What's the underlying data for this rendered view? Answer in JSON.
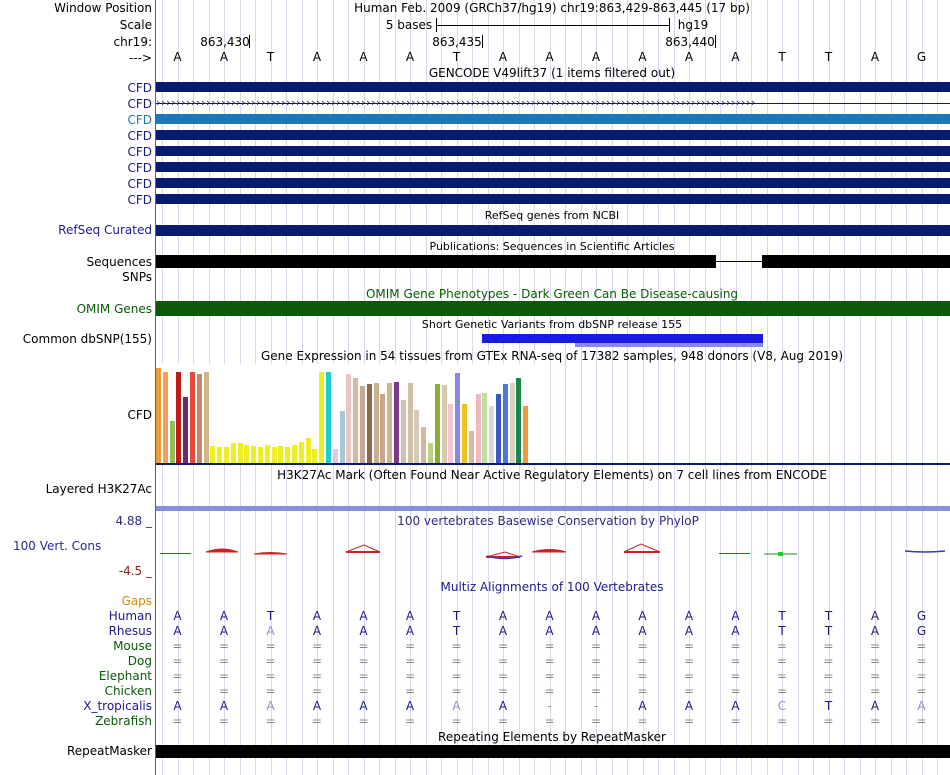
{
  "header": {
    "window_position_label": "Window Position",
    "window_position_text": "Human Feb. 2009 (GRCh37/hg19)   chr19:863,429-863,445 (17 bp)",
    "scale_label": "Scale",
    "scale_text": "5 bases",
    "assembly": "hg19",
    "chrom_label": "chr19:",
    "ticks": [
      "863,430",
      "863,435",
      "863,440"
    ],
    "strand_label": "--->"
  },
  "bases": [
    "A",
    "A",
    "T",
    "A",
    "A",
    "A",
    "T",
    "A",
    "A",
    "A",
    "A",
    "A",
    "A",
    "T",
    "T",
    "A",
    "G"
  ],
  "tracks": {
    "gencode_title": "GENCODE V49lift37 (1 items filtered out)",
    "gencode_items": [
      "CFD",
      "CFD",
      "CFD",
      "CFD",
      "CFD",
      "CFD",
      "CFD",
      "CFD"
    ],
    "refseq_title": "RefSeq genes from NCBI",
    "refseq_label": "RefSeq Curated",
    "publications_title": "Publications: Sequences in Scientific Articles",
    "sequences_label": "Sequences",
    "snps_label": "SNPs",
    "omim_label": "OMIM Genes",
    "omim_title": "OMIM Gene Phenotypes - Dark Green Can Be Disease-causing",
    "dbsnp_title": "Short Genetic Variants from dbSNP release 155",
    "dbsnp_label": "Common dbSNP(155)",
    "gtex_title": "Gene Expression in 54 tissues from GTEx RNA-seq of 17382 samples, 948 donors (V8, Aug 2019)",
    "gtex_label": "CFD",
    "h3k27_title": "H3K27Ac Mark (Often Found Near Active Regulatory Elements) on 7 cell lines from ENCODE",
    "h3k27_label": "Layered H3K27Ac",
    "phylop_max": "4.88 _",
    "phylop_title": "100 vertebrates Basewise Conservation by PhyloP",
    "phylop_label": "100 Vert. Cons",
    "phylop_min": "-4.5 _",
    "multiz_title": "Multiz Alignments of 100 Vertebrates",
    "gaps_label": "Gaps",
    "repeat_title": "Repeating Elements by RepeatMasker",
    "repeat_label": "RepeatMasker"
  },
  "alignment": [
    {
      "species": "Human",
      "row": [
        "A",
        "A",
        "T",
        "A",
        "A",
        "A",
        "T",
        "A",
        "A",
        "A",
        "A",
        "A",
        "A",
        "T",
        "T",
        "A",
        "G"
      ]
    },
    {
      "species": "Rhesus",
      "row": [
        "A",
        "A",
        "A",
        "A",
        "A",
        "A",
        "T",
        "A",
        "A",
        "A",
        "A",
        "A",
        "A",
        "T",
        "T",
        "A",
        "G"
      ]
    },
    {
      "species": "Mouse",
      "row": [
        "=",
        "=",
        "=",
        "=",
        "=",
        "=",
        "=",
        "=",
        "=",
        "=",
        "=",
        "=",
        "=",
        "=",
        "=",
        "=",
        "="
      ]
    },
    {
      "species": "Dog",
      "row": [
        "=",
        "=",
        "=",
        "=",
        "=",
        "=",
        "=",
        "=",
        "=",
        "=",
        "=",
        "=",
        "=",
        "=",
        "=",
        "=",
        "="
      ]
    },
    {
      "species": "Elephant",
      "row": [
        "=",
        "=",
        "=",
        "=",
        "=",
        "=",
        "=",
        "=",
        "=",
        "=",
        "=",
        "=",
        "=",
        "=",
        "=",
        "=",
        "="
      ]
    },
    {
      "species": "Chicken",
      "row": [
        "=",
        "=",
        "=",
        "=",
        "=",
        "=",
        "=",
        "=",
        "=",
        "=",
        "=",
        "=",
        "=",
        "=",
        "=",
        "=",
        "="
      ]
    },
    {
      "species": "X_tropicalis",
      "row": [
        "A",
        "A",
        "A",
        "A",
        "A",
        "A",
        "A",
        "A",
        "-",
        "-",
        "A",
        "A",
        "A",
        "C",
        "T",
        "A",
        "A"
      ]
    },
    {
      "species": "Zebrafish",
      "row": [
        "=",
        "=",
        "=",
        "=",
        "=",
        "=",
        "=",
        "=",
        "=",
        "=",
        "=",
        "=",
        "=",
        "=",
        "=",
        "=",
        "="
      ]
    }
  ],
  "colors": {
    "gene_navy": "#0a1a6e",
    "gene_highlight": "#1a78b8",
    "label_navy": "#1a1a8c",
    "omim_green": "#0a5a0a",
    "gaps_orange": "#d88a00",
    "phylop_max_color": "#2a2a8a",
    "phylop_min_color": "#8a1a1a",
    "dbsnp_blue": "#1a1ae0",
    "h3k27_bar": "#8890dd"
  },
  "gtex_colors": [
    "#f29a36",
    "#f2a15a",
    "#8fbc5c",
    "#c01a1a",
    "#6a2a6a",
    "#e84a3a",
    "#c08a6a",
    "#d2b48c",
    "#f0f01a",
    "#eeee22",
    "#eeee22",
    "#eeee22",
    "#eeee22",
    "#eeee22",
    "#eeee22",
    "#eeee22",
    "#eeee22",
    "#eeee22",
    "#eeee22",
    "#eeee22",
    "#eeee22",
    "#eeee22",
    "#eeee22",
    "#eeee22",
    "#eeee22",
    "#1ccfcf",
    "#e4c8e8",
    "#a8c8d8",
    "#e8c8c0",
    "#d8b8a0",
    "#c8a890",
    "#8a6a4a",
    "#c8b090",
    "#c8a888",
    "#d2b48c",
    "#7a3a8a",
    "#d8c0a8",
    "#d0c0a8",
    "#d8c8b8",
    "#d0b8a0",
    "#c0d080",
    "#88b030",
    "#d8c8b0",
    "#f0c8d0",
    "#8888e0",
    "#f0c020",
    "#d8b8a8",
    "#f0b8c0",
    "#c0e0a0",
    "#d8d8d8",
    "#3a58c8",
    "#4a78d8",
    "#d8d0c0",
    "#18884a"
  ],
  "gtex_values": [
    0.96,
    0.92,
    0.42,
    0.92,
    0.67,
    0.92,
    0.9,
    0.92,
    0.17,
    0.16,
    0.16,
    0.2,
    0.2,
    0.18,
    0.17,
    0.16,
    0.18,
    0.16,
    0.17,
    0.16,
    0.18,
    0.21,
    0.25,
    0.14,
    0.92,
    0.92,
    0.14,
    0.53,
    0.9,
    0.86,
    0.78,
    0.8,
    0.81,
    0.7,
    0.81,
    0.82,
    0.64,
    0.81,
    0.54,
    0.36,
    0.2,
    0.8,
    0.79,
    0.6,
    0.91,
    0.6,
    0.32,
    0.7,
    0.71,
    0.58,
    0.7,
    0.8,
    0.81,
    0.86,
    0.58
  ]
}
